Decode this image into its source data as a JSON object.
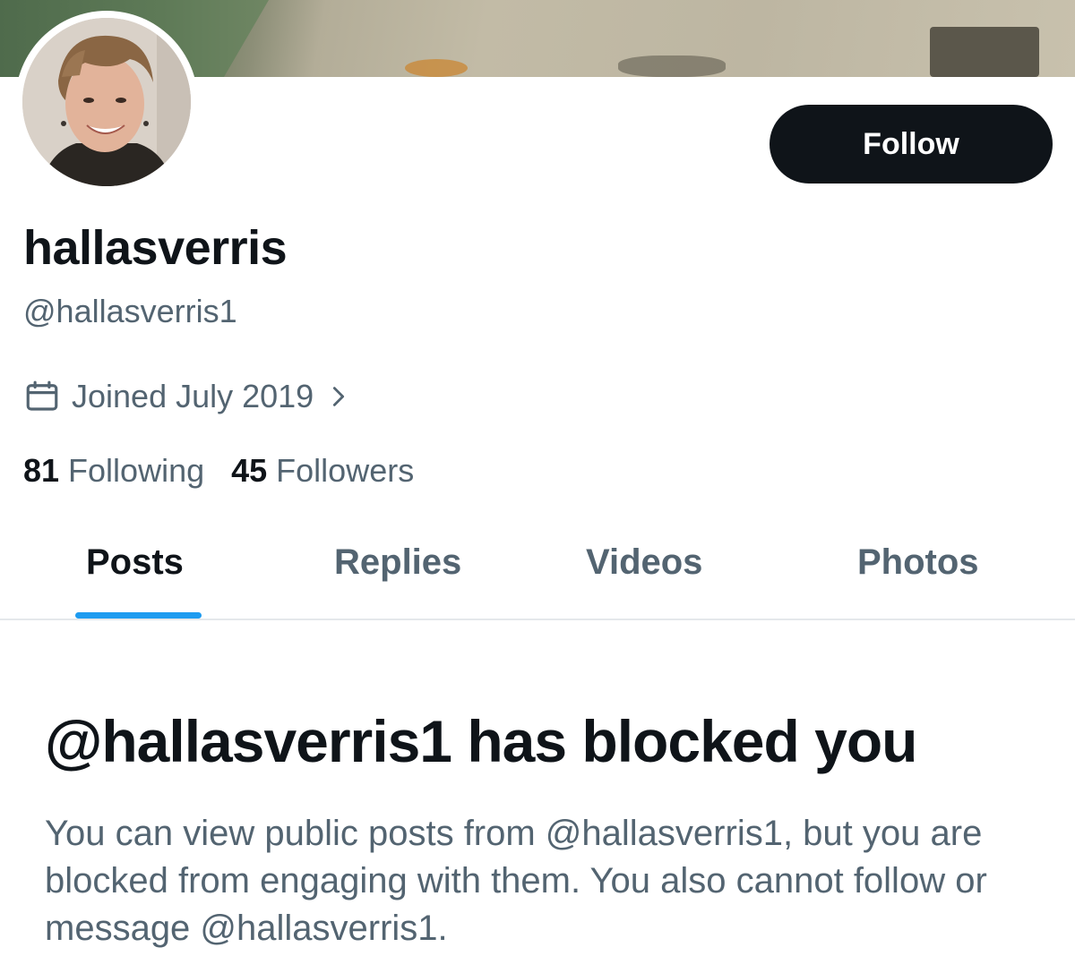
{
  "profile": {
    "display_name": "hallasverris",
    "handle": "@hallasverris1",
    "joined": "Joined July 2019",
    "following_count": "81",
    "following_label": "Following",
    "followers_count": "45",
    "followers_label": "Followers"
  },
  "actions": {
    "follow_label": "Follow"
  },
  "tabs": [
    {
      "label": "Posts",
      "active": true
    },
    {
      "label": "Replies",
      "active": false
    },
    {
      "label": "Videos",
      "active": false
    },
    {
      "label": "Photos",
      "active": false
    }
  ],
  "blocked": {
    "title": "@hallasverris1 has blocked you",
    "body": "You can view public posts from @hallasverris1, but you are blocked from engaging with them. You also cannot follow or message @hallasverris1."
  },
  "colors": {
    "accent": "#1d9bf0",
    "text_primary": "#0f1419",
    "text_secondary": "#536471",
    "button_bg": "#0f1419"
  },
  "icons": {
    "joined": "calendar-icon",
    "joined_more": "chevron-right-icon"
  }
}
